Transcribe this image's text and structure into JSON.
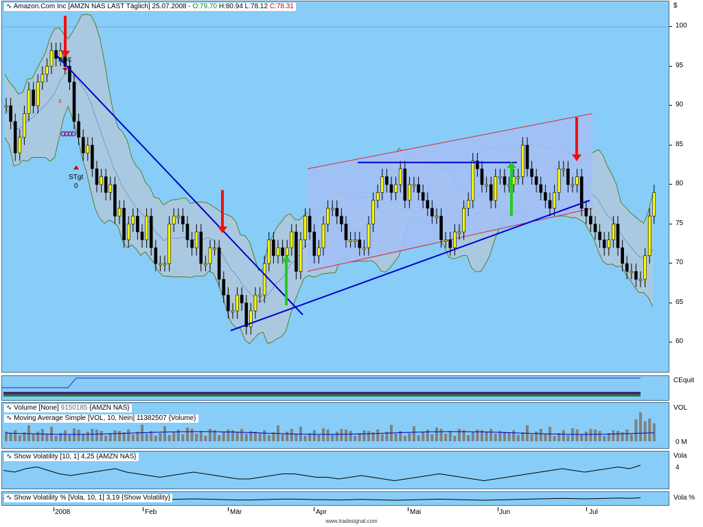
{
  "header": {
    "symbol": "Amazon.Com Inc [AMZN NAS LAST Täglich] 25.07.2008 - ",
    "open": "O:79.70",
    "high": "H:80.94",
    "low": "L:78.12",
    "close": "C:78.31",
    "currency": "$"
  },
  "panels": {
    "equity_label": "CEquit",
    "volume_title": "Volume [None] ",
    "volume_value": "9150185",
    "volume_rest": " {AMZN NAS}",
    "ma_title": "Moving Average Simple [VOL, 10, Nein] 11382507 {Volume}",
    "volume_label": "VOL",
    "volume_tick": "0 M",
    "volatility_title": "Show Volatility [10, 1] 4,25 {AMZN NAS}",
    "volatility_label": "Vola",
    "volatility_tick": "4",
    "volatility_pct_title": "Show Volatility % [Vola, 10, 1] 3,19 {Show Volatility}",
    "volatility_pct_label": "Vola %"
  },
  "annotations": {
    "poc": "POC",
    "stgt": "STgt",
    "stgt_value": "0",
    "small3": "3"
  },
  "footer": "www.tradesignal.com",
  "chart_data": {
    "type": "candlestick",
    "title": "Amazon.Com Inc [AMZN NAS LAST Täglich] 25.07.2008",
    "ylabel": "$",
    "ylim": [
      56,
      103
    ],
    "yticks": [
      60,
      65,
      70,
      75,
      80,
      85,
      90,
      95,
      100
    ],
    "x_labels": [
      "2008",
      "Feb",
      "Mär",
      "Apr",
      "Mai",
      "Jun",
      "Jul"
    ],
    "colors": {
      "up": "#ffff00",
      "down": "#000000",
      "background": "#87cdf7",
      "band_fill": "#b0c8dc",
      "channel_fill": "#a2c0f5",
      "trendline": "#0000cc",
      "sell_arrow": "#ee1111",
      "buy_arrow": "#22cc22"
    },
    "closes": [
      90,
      88,
      84,
      86,
      89,
      92,
      90,
      93,
      94,
      95,
      97,
      96,
      97,
      95,
      93,
      88,
      86,
      84,
      85,
      82,
      80,
      81,
      79,
      80,
      76,
      77,
      73,
      75,
      76,
      74,
      73,
      76,
      72,
      70,
      70,
      70,
      75,
      76,
      76,
      75,
      73,
      72,
      74,
      70,
      70,
      72,
      72,
      68,
      66,
      64,
      64,
      66,
      65,
      62,
      64,
      66,
      66,
      70,
      73,
      71,
      72,
      71,
      72,
      74,
      69,
      73,
      76,
      74,
      71,
      72,
      75,
      77,
      77,
      76,
      75,
      73,
      73,
      73,
      72,
      72,
      75,
      78,
      79,
      81,
      80,
      79,
      80,
      82,
      78,
      80,
      80,
      79,
      78,
      77,
      76,
      76,
      73,
      73,
      72,
      74,
      74,
      77,
      78,
      83,
      82,
      80,
      80,
      78,
      81,
      81,
      80,
      80,
      81,
      81,
      85,
      82,
      81,
      80,
      79,
      78,
      77,
      79,
      82,
      82,
      80,
      80,
      81,
      77,
      76,
      75,
      74,
      73,
      72,
      73,
      75,
      72,
      70,
      69,
      69,
      68,
      68,
      71,
      76,
      79
    ],
    "volatility_trace": [
      4.1,
      4.0,
      4.2,
      4.3,
      4.1,
      3.9,
      3.8,
      3.9,
      4.0,
      4.1,
      4.2,
      4.0,
      3.9,
      3.8,
      3.7,
      3.8,
      3.9,
      4.0,
      3.9,
      3.8,
      3.7,
      3.6,
      3.6,
      3.7,
      3.8,
      3.9,
      3.9,
      3.8,
      3.7,
      3.7,
      3.6,
      3.7,
      3.8,
      3.7,
      3.6,
      3.5,
      3.6,
      3.7,
      3.8,
      3.9,
      3.8,
      3.7,
      3.6,
      3.5,
      3.6,
      3.7,
      3.8,
      3.9,
      4.0,
      4.1,
      4.2,
      4.1,
      4.0,
      4.1,
      4.2,
      4.3,
      4.2,
      4.4
    ],
    "trendlines": [
      {
        "name": "downtrend",
        "from": [
          "2008",
          96.5
        ],
        "to": [
          "Apr",
          63.5
        ]
      },
      {
        "name": "uptrend",
        "from": [
          "Mär",
          61.5
        ],
        "to": [
          "Jul",
          78
        ]
      },
      {
        "name": "resistance",
        "from": [
          "Mär",
          82.8
        ],
        "to": [
          "Jun",
          82.8
        ]
      }
    ],
    "channel": {
      "upper": [
        82,
        89
      ],
      "lower": [
        69,
        77
      ],
      "span": [
        "Apr",
        "Jul"
      ]
    },
    "signals": [
      {
        "type": "sell",
        "label": "POC"
      },
      {
        "type": "sell"
      },
      {
        "type": "buy"
      },
      {
        "type": "buy"
      },
      {
        "type": "sell"
      }
    ]
  }
}
